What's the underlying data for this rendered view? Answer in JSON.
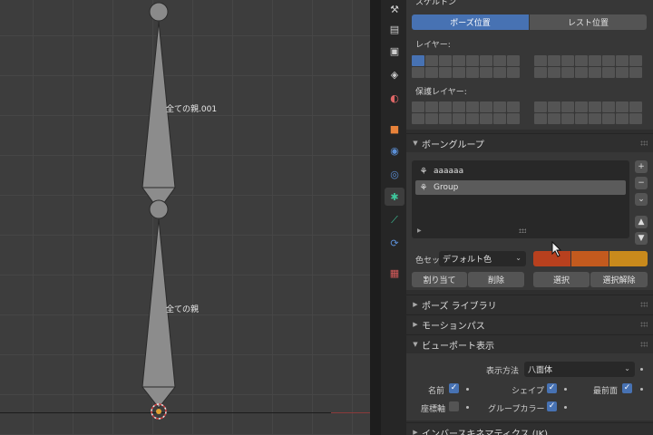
{
  "viewport": {
    "bones": [
      {
        "label": "全ての親.001"
      },
      {
        "label": "全ての親"
      }
    ]
  },
  "tabs": [
    {
      "icon": "tool-icon"
    },
    {
      "icon": "render-icon"
    },
    {
      "icon": "output-icon"
    },
    {
      "icon": "view-layer-icon"
    },
    {
      "icon": "scene-icon"
    },
    {
      "icon": "world-icon"
    },
    {
      "icon": "object-icon"
    },
    {
      "icon": "modifier-icon"
    },
    {
      "icon": "physics-icon"
    },
    {
      "icon": "armature-data-icon",
      "active": true
    },
    {
      "icon": "bone-icon"
    },
    {
      "icon": "bone-constraint-icon"
    },
    {
      "icon": "texture-icon"
    }
  ],
  "skeleton": {
    "title_partial": "スケルトン",
    "pose_position_label": "ポーズ位置",
    "rest_position_label": "レスト位置",
    "layers_label": "レイヤー:",
    "protected_layers_label": "保護レイヤー:"
  },
  "bone_groups": {
    "title": "ボーングループ",
    "items": [
      {
        "name": "aaaaaa",
        "selected": false
      },
      {
        "name": "Group",
        "selected": true
      }
    ],
    "add_label": "+",
    "remove_label": "−",
    "menu_label": "⌄",
    "up_label": "▲",
    "down_label": "▼",
    "color_set_label": "色セット",
    "color_set_value": "デフォルト色",
    "colors": [
      "#b8401e",
      "#c35a1e",
      "#c98a1c"
    ],
    "assign_label": "割り当て",
    "remove_btn_label": "削除",
    "select_label": "選択",
    "deselect_label": "選択解除"
  },
  "pose_library": {
    "title": "ポーズ ライブラリ"
  },
  "motion_paths": {
    "title": "モーションパス"
  },
  "viewport_display": {
    "title": "ビューポート表示",
    "display_as_label": "表示方法",
    "display_as_value": "八面体",
    "names_label": "名前",
    "names_checked": true,
    "shapes_label": "シェイプ",
    "shapes_checked": true,
    "in_front_label": "最前面",
    "in_front_checked": true,
    "axes_label": "座標軸",
    "axes_checked": false,
    "group_colors_label": "グループカラー",
    "group_colors_checked": true
  },
  "inverse_kinematics": {
    "title": "インバースキネマティクス (IK)"
  }
}
